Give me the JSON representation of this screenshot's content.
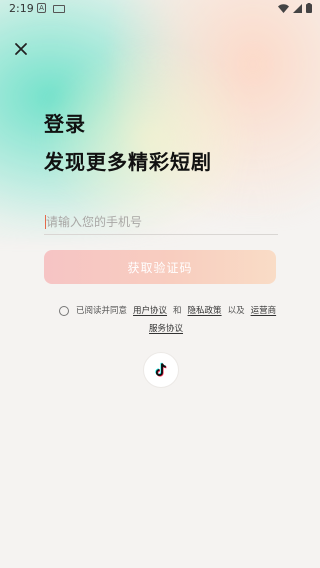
{
  "status_bar": {
    "time": "2:19",
    "left_icons": [
      "a-badge-icon",
      "keyboard-icon"
    ],
    "right_icons": [
      "wifi-icon",
      "signal-icon",
      "battery-icon"
    ]
  },
  "header": {
    "close_icon": "close-icon"
  },
  "titles": {
    "line1": "登录",
    "line2": "发现更多精彩短剧"
  },
  "form": {
    "phone_placeholder": "请输入您的手机号",
    "phone_value": "",
    "submit_label": "获取验证码"
  },
  "agreement": {
    "prefix": "已阅读并同意",
    "user_agreement": "用户协议",
    "and": "和",
    "privacy_policy": "隐私政策",
    "and2": "以及",
    "operator": "运营商",
    "service_agreement": "服务协议",
    "checked": false
  },
  "social": {
    "login_icon": "tiktok-icon"
  },
  "colors": {
    "button_gradient_start": "#f6c4c4",
    "button_gradient_end": "#f9dcc6",
    "teal_glow": "#5cdec4",
    "peach_glow": "#fcd6c4",
    "caret": "#e56a4b"
  }
}
